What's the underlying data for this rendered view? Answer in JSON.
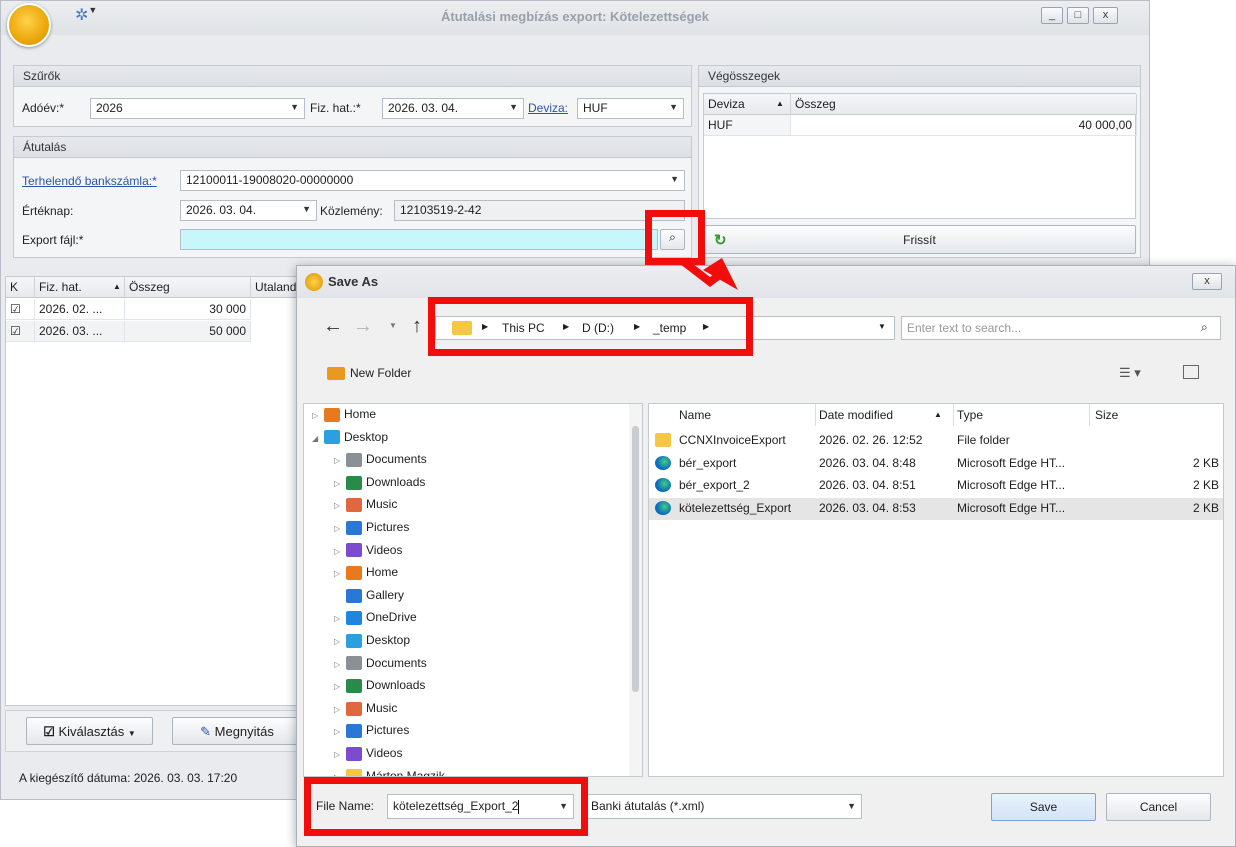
{
  "window": {
    "title": "Átutalási megbízás export: Kötelezettségek",
    "controls": [
      "_",
      "□",
      "x"
    ]
  },
  "filters": {
    "title": "Szűrők",
    "year_label": "Adóév:*",
    "year_value": "2026",
    "due_label": "Fiz. hat.:*",
    "due_value": "2026. 03. 04.",
    "currency_label": "Deviza:",
    "currency_value": "HUF"
  },
  "transfer": {
    "title": "Átutalás",
    "account_label": "Terhelendő bankszámla:*",
    "account_value": "12100011-19008020-00000000",
    "value_date_label": "Értéknap:",
    "value_date_value": "2026. 03. 04.",
    "note_label": "Közlemény:",
    "note_value": "12103519-2-42",
    "export_label": "Export fájl:*",
    "export_value": ""
  },
  "totals": {
    "title": "Végösszegek",
    "columns": [
      "Deviza",
      "Összeg"
    ],
    "rows": [
      {
        "currency": "HUF",
        "amount": "40 000,00"
      }
    ],
    "refresh_label": "Frissít"
  },
  "grid": {
    "columns": [
      "K",
      "Fiz. hat.",
      "Összeg",
      "Utaland"
    ],
    "rows": [
      {
        "checked": true,
        "date": "2026. 02. ...",
        "amount": "30 000"
      },
      {
        "checked": true,
        "date": "2026. 03. ...",
        "amount": "50 000"
      }
    ]
  },
  "bottom": {
    "select_label": "Kiválasztás",
    "open_label": "Megnyitás",
    "status": "A kiegészítő dátuma: 2026. 03. 03. 17:20"
  },
  "dialog": {
    "title": "Save As",
    "path": [
      "This PC",
      "D (D:)",
      "_temp"
    ],
    "search_placeholder": "Enter text to search...",
    "new_folder": "New Folder",
    "tree": [
      {
        "label": "Home",
        "icon": "home",
        "indent": 0,
        "arrow": "right"
      },
      {
        "label": "Desktop",
        "icon": "desktop",
        "indent": 0,
        "arrow": "down"
      },
      {
        "label": "Documents",
        "icon": "documents",
        "indent": 1,
        "arrow": "right"
      },
      {
        "label": "Downloads",
        "icon": "downloads",
        "indent": 1,
        "arrow": "right"
      },
      {
        "label": "Music",
        "icon": "music",
        "indent": 1,
        "arrow": "right"
      },
      {
        "label": "Pictures",
        "icon": "pictures",
        "indent": 1,
        "arrow": "right"
      },
      {
        "label": "Videos",
        "icon": "videos",
        "indent": 1,
        "arrow": "right"
      },
      {
        "label": "Home",
        "icon": "home",
        "indent": 1,
        "arrow": "right"
      },
      {
        "label": "Gallery",
        "icon": "gallery",
        "indent": 1,
        "arrow": ""
      },
      {
        "label": "OneDrive",
        "icon": "onedrive",
        "indent": 1,
        "arrow": "right"
      },
      {
        "label": "Desktop",
        "icon": "desktop",
        "indent": 1,
        "arrow": "right"
      },
      {
        "label": "Documents",
        "icon": "documents",
        "indent": 1,
        "arrow": "right"
      },
      {
        "label": "Downloads",
        "icon": "downloads",
        "indent": 1,
        "arrow": "right"
      },
      {
        "label": "Music",
        "icon": "music",
        "indent": 1,
        "arrow": "right"
      },
      {
        "label": "Pictures",
        "icon": "pictures",
        "indent": 1,
        "arrow": "right"
      },
      {
        "label": "Videos",
        "icon": "videos",
        "indent": 1,
        "arrow": "right"
      },
      {
        "label": "Márton Magzik",
        "icon": "folder",
        "indent": 1,
        "arrow": "right"
      }
    ],
    "columns": [
      "Name",
      "Date modified",
      "Type",
      "Size"
    ],
    "files": [
      {
        "name": "CCNXInvoiceExport",
        "date": "2026. 02. 26. 12:52",
        "type": "File folder",
        "size": "",
        "icon": "folder"
      },
      {
        "name": "bér_export",
        "date": "2026. 03. 04. 8:48",
        "type": "Microsoft Edge HT...",
        "size": "2 KB",
        "icon": "edge"
      },
      {
        "name": "bér_export_2",
        "date": "2026. 03. 04. 8:51",
        "type": "Microsoft Edge HT...",
        "size": "2 KB",
        "icon": "edge"
      },
      {
        "name": "kötelezettség_Export",
        "date": "2026. 03. 04. 8:53",
        "type": "Microsoft Edge HT...",
        "size": "2 KB",
        "icon": "edge"
      }
    ],
    "filename_label": "File Name:",
    "filename_value": "kötelezettség_Export_2",
    "filetype_value": "Banki átutalás (*.xml)",
    "save_label": "Save",
    "cancel_label": "Cancel"
  },
  "colors": {
    "highlight": "#f20d0d",
    "accent": "#2d54a8",
    "export_field": "#c8f7fb"
  }
}
